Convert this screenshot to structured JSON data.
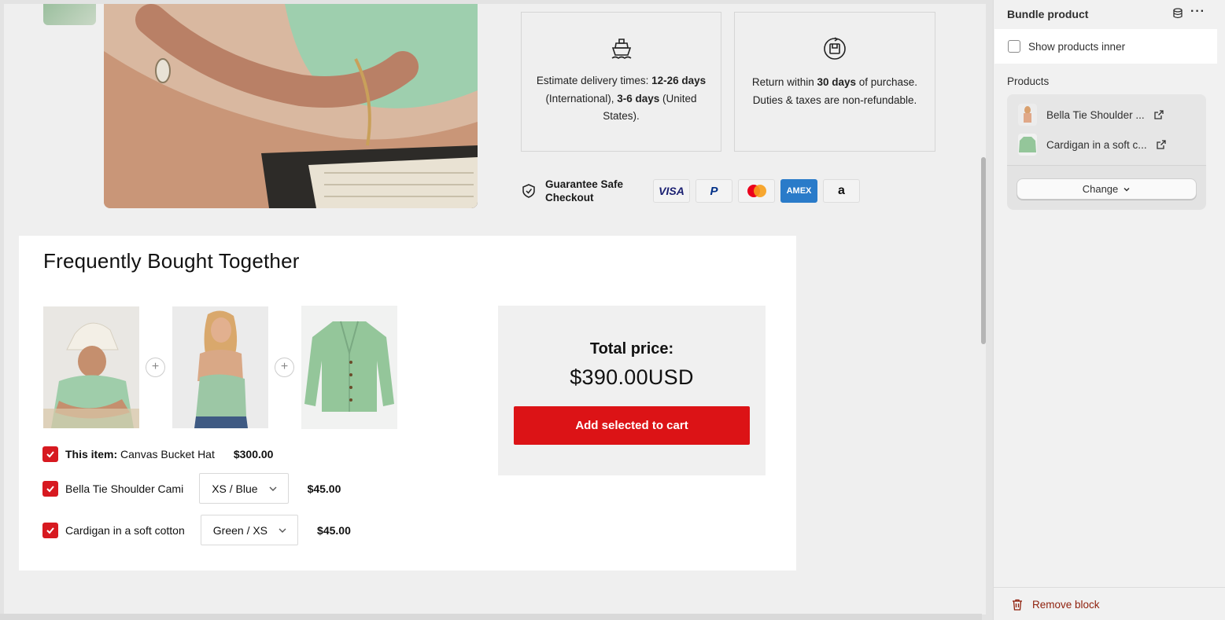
{
  "delivery": {
    "pre": "Estimate delivery times: ",
    "b1": "12-26 days",
    "mid": " (International), ",
    "b2": "3-6 days",
    "post": " (United States)."
  },
  "returns": {
    "pre": "Return within ",
    "b1": "30 days",
    "post": " of purchase. Duties & taxes are non-refundable."
  },
  "guarantee_label": "Guarantee Safe Checkout",
  "payment_methods": [
    "VISA",
    "P",
    "mastercard",
    "AMEX",
    "a"
  ],
  "fbt": {
    "title": "Frequently Bought Together",
    "items": [
      {
        "prefix": "This item:",
        "name": "Canvas Bucket Hat",
        "price": "$300.00",
        "checked": true
      },
      {
        "name": "Bella Tie Shoulder Cami",
        "variant": "XS / Blue",
        "price": "$45.00",
        "checked": true
      },
      {
        "name": "Cardigan in a soft cotton",
        "variant": "Green / XS",
        "price": "$45.00",
        "checked": true
      }
    ],
    "total_label": "Total price:",
    "total_value": "$390.00USD",
    "add_button": "Add selected to cart"
  },
  "panel": {
    "title": "Bundle product",
    "show_inner_label": "Show products inner",
    "show_inner_checked": false,
    "products_label": "Products",
    "products": [
      "Bella Tie Shoulder ...",
      "Cardigan in a soft c..."
    ],
    "change_label": "Change",
    "remove_label": "Remove block"
  },
  "colors": {
    "accent": "#dc1316",
    "checkbox": "#d71920",
    "danger_text": "#8e1f0b"
  }
}
